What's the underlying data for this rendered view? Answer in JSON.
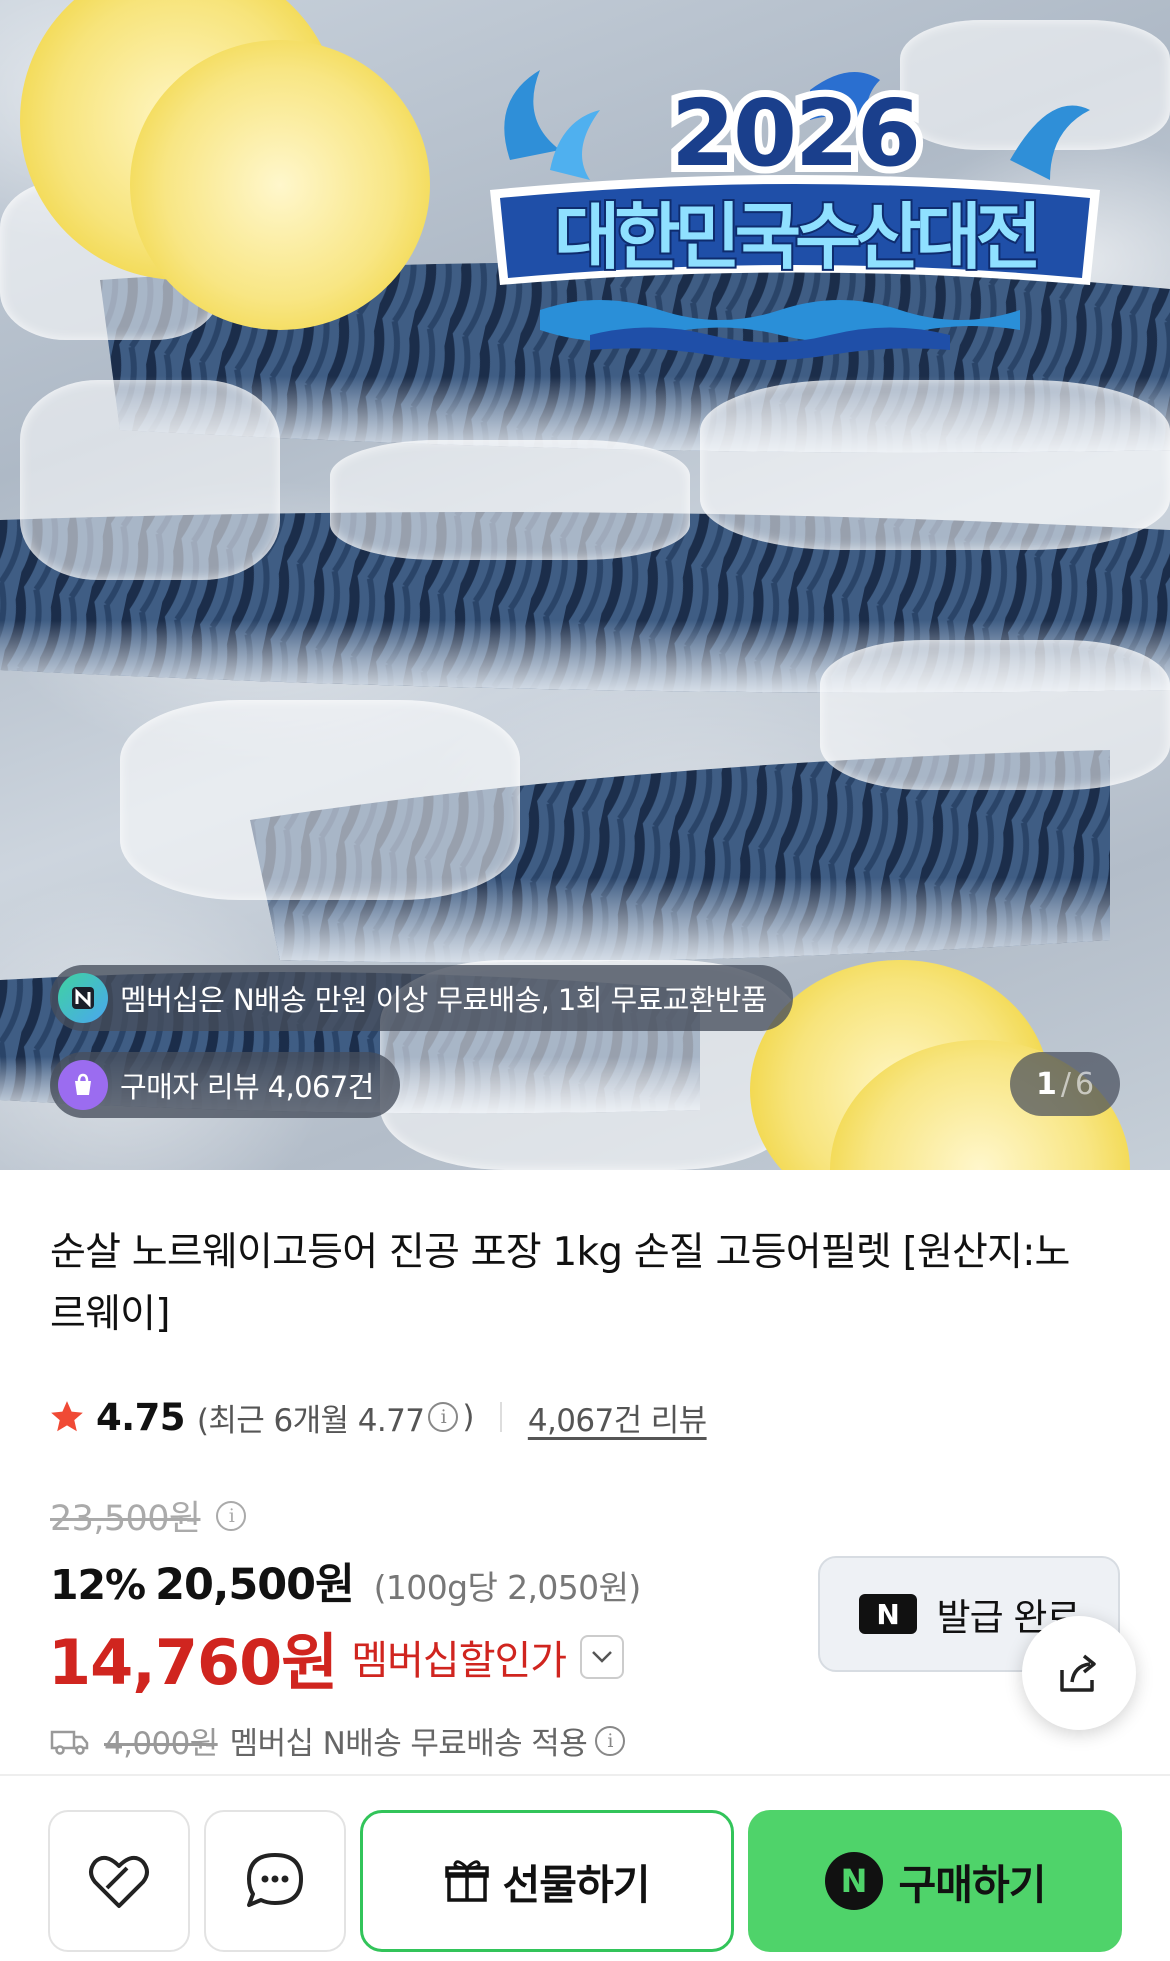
{
  "hero": {
    "logo": {
      "year": "2026",
      "name": "대한민국수산대전"
    },
    "membership_pill": {
      "icon": "n-delivery-icon",
      "text": "멤버십은 N배송 만원 이상 무료배송, 1회 무료교환반품"
    },
    "review_pill": {
      "icon": "shopping-bag-icon",
      "text": "구매자 리뷰 4,067건"
    },
    "image_counter": {
      "current": "1",
      "separator": "/",
      "total": "6"
    }
  },
  "product": {
    "title": "순살 노르웨이고등어 진공 포장 1kg 손질 고등어필렛 [원산지:노르웨이]",
    "rating": {
      "star_icon": "star-icon",
      "score": "4.75",
      "recent_prefix": "(최근 6개월 4.77",
      "recent_suffix": ")",
      "review_link": "4,067건 리뷰"
    },
    "original_price": "23,500원",
    "discount": "12%",
    "sale_price": "20,500원",
    "unit_price": "(100g당 2,050원)",
    "membership_price": "14,760원",
    "membership_label": "멤버십할인가",
    "coupon_button": {
      "logo": "N",
      "label": "발급 완료"
    },
    "delivery": {
      "icon": "truck-icon",
      "original_fee": "4,000원",
      "text": "멤버십 N배송 무료배송 적용"
    }
  },
  "bottom_bar": {
    "wishlist_icon": "heart-icon",
    "chat_icon": "chat-bubble-icon",
    "gift_button": {
      "icon": "gift-icon",
      "label": "선물하기"
    },
    "buy_button": {
      "logo": "N",
      "label": "구매하기"
    }
  },
  "colors": {
    "sale_red": "#d0251f",
    "naver_green": "#4fd36a",
    "gift_border": "#32c45a",
    "logo_blue": "#1f4fa8",
    "pill_bg": "#464e5c"
  }
}
